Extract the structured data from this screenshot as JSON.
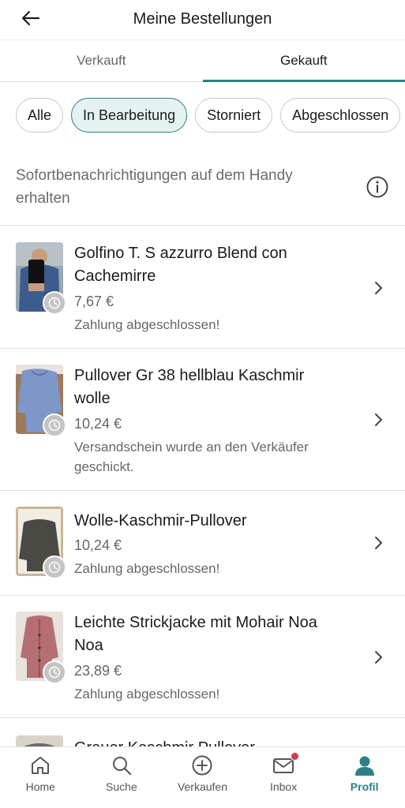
{
  "header": {
    "title": "Meine Bestellungen"
  },
  "tabs": [
    {
      "label": "Verkauft",
      "active": false
    },
    {
      "label": "Gekauft",
      "active": true
    }
  ],
  "filters": [
    {
      "label": "Alle",
      "selected": false
    },
    {
      "label": "In Bearbeitung",
      "selected": true
    },
    {
      "label": "Storniert",
      "selected": false
    },
    {
      "label": "Abgeschlossen",
      "selected": false
    }
  ],
  "notification": {
    "text": "Sofortbenachrichtigungen auf dem Handy erhalten"
  },
  "orders": [
    {
      "title": "Golfino T. S azzurro Blend con Cachemirre",
      "price": "7,67 €",
      "status": "Zahlung abgeschlossen!"
    },
    {
      "title": "Pullover Gr 38 hellblau Kaschmir wolle",
      "price": "10,24 €",
      "status": "Versandschein wurde an den Verkäufer geschickt."
    },
    {
      "title": "Wolle-Kaschmir-Pullover",
      "price": "10,24 €",
      "status": "Zahlung abgeschlossen!"
    },
    {
      "title": "Leichte Strickjacke mit Mohair Noa Noa",
      "price": "23,89 €",
      "status": "Zahlung abgeschlossen!"
    },
    {
      "title": "Grauer Kaschmir Pullover",
      "price": "",
      "status": ""
    }
  ],
  "bottom_nav": [
    {
      "label": "Home",
      "icon": "home-icon",
      "active": false
    },
    {
      "label": "Suche",
      "icon": "search-icon",
      "active": false
    },
    {
      "label": "Verkaufen",
      "icon": "plus-circle-icon",
      "active": false
    },
    {
      "label": "Inbox",
      "icon": "mail-icon",
      "active": false,
      "badge": true
    },
    {
      "label": "Profil",
      "icon": "profile-icon",
      "active": true
    }
  ],
  "colors": {
    "accent": "#2f7f85",
    "badge": "#d1394a",
    "chip_selected_bg": "#e5f2f2"
  }
}
